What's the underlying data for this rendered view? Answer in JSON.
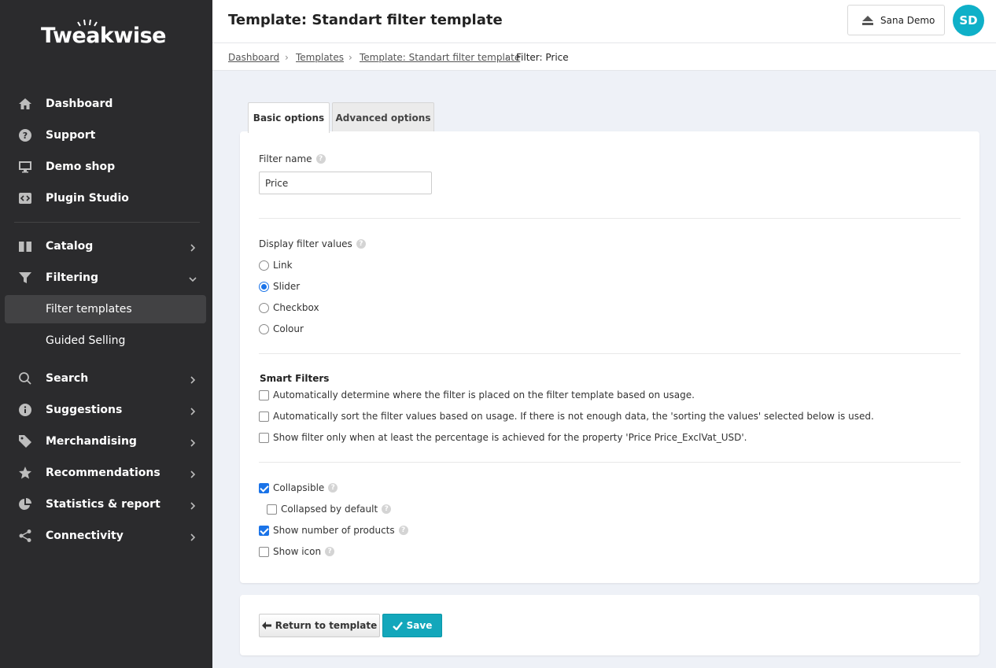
{
  "sidebar": {
    "logo": "Tweakwise",
    "items_top": [
      {
        "label": "Dashboard",
        "icon": "home-icon"
      },
      {
        "label": "Support",
        "icon": "question-circle-icon"
      },
      {
        "label": "Demo shop",
        "icon": "monitor-icon"
      },
      {
        "label": "Plugin Studio",
        "icon": "code-icon"
      }
    ],
    "catalog": {
      "label": "Catalog",
      "icon": "book-icon"
    },
    "filtering": {
      "label": "Filtering",
      "icon": "funnel-icon"
    },
    "filter_templates": {
      "label": "Filter templates"
    },
    "guided_selling": {
      "label": "Guided Selling"
    },
    "items_bottom": [
      {
        "label": "Search",
        "icon": "search-icon"
      },
      {
        "label": "Suggestions",
        "icon": "info-circle-icon"
      },
      {
        "label": "Merchandising",
        "icon": "tag-icon"
      },
      {
        "label": "Recommendations",
        "icon": "star-icon"
      },
      {
        "label": "Statistics & report",
        "icon": "pie-chart-icon"
      },
      {
        "label": "Connectivity",
        "icon": "share-icon"
      }
    ]
  },
  "header": {
    "title": "Template: Standart filter template",
    "account_label": "Sana Demo",
    "avatar_initials": "SD"
  },
  "breadcrumb": {
    "dashboard": "Dashboard",
    "templates": "Templates",
    "template": "Template: Standart filter template",
    "current": "Filter: Price",
    "sep": "›"
  },
  "tabs": {
    "basic": "Basic options",
    "advanced": "Advanced options"
  },
  "form": {
    "filter_name_label": "Filter name",
    "filter_name_value": "Price",
    "display_label": "Display filter values",
    "display_options": [
      "Link",
      "Slider",
      "Checkbox",
      "Colour"
    ],
    "display_selected": "Slider",
    "smart_title": "Smart Filters",
    "smart_options": [
      "Automatically determine where the filter is placed on the filter template based on usage.",
      "Automatically sort the filter values based on usage. If there is not enough data, the 'sorting the values' selected below is used.",
      "Show filter only when at least the percentage is achieved for the property 'Price Price_ExclVat_USD'."
    ],
    "collapsible": "Collapsible",
    "collapsed_default": "Collapsed by default",
    "show_number": "Show number of products",
    "show_icon": "Show icon",
    "help": "?"
  },
  "actions": {
    "return_label": "Return to template",
    "save_label": "Save"
  },
  "colors": {
    "sidebar_bg": "#2b2b2d",
    "accent": "#13a7bb",
    "checkbox_blue": "#1a73e8"
  }
}
